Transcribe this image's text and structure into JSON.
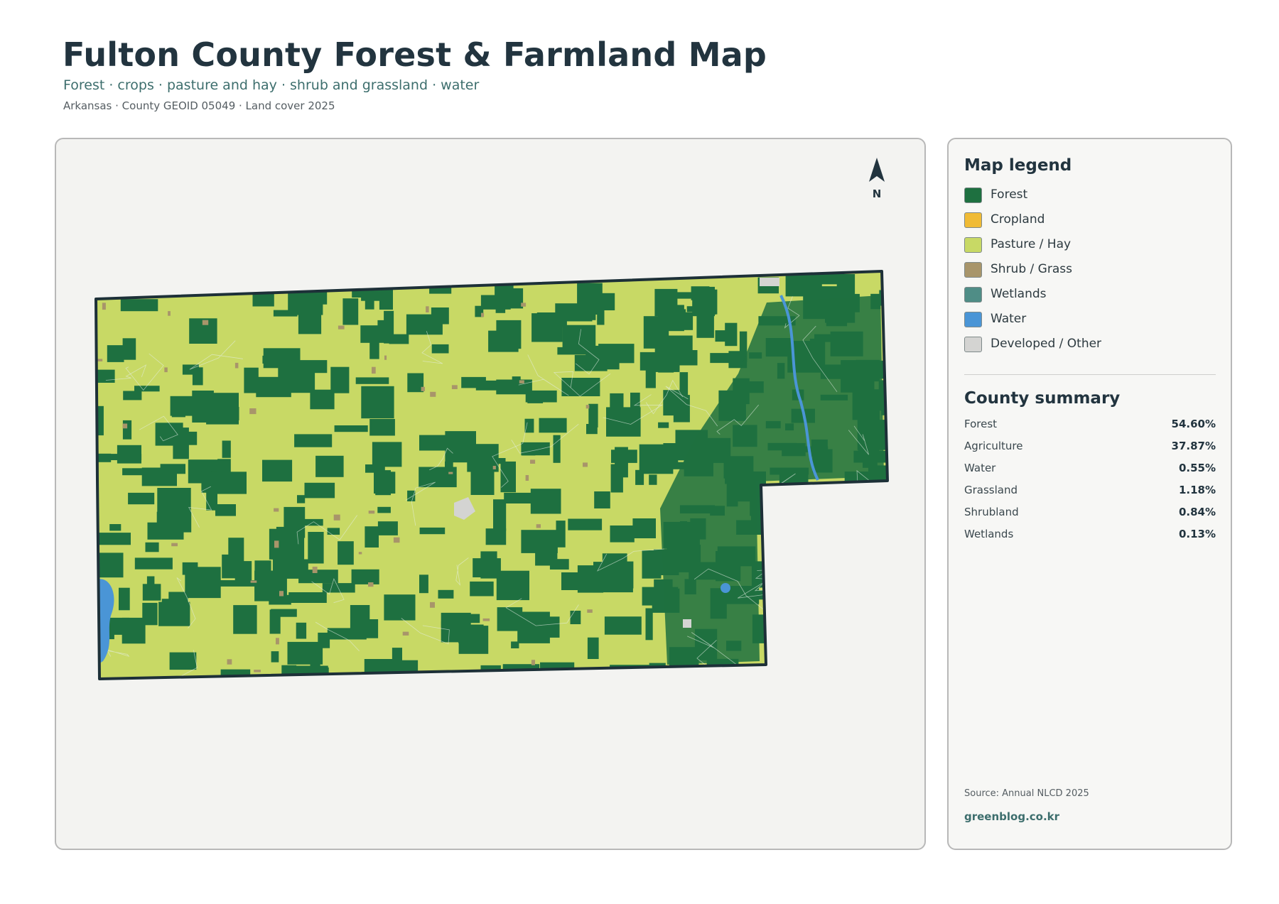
{
  "header": {
    "title": "Fulton County Forest & Farmland Map",
    "subtitle": "Forest · crops · pasture and hay · shrub and grassland · water",
    "meta": "Arkansas · County GEOID 05049 · Land cover 2025"
  },
  "map": {
    "north_label": "N",
    "colors": {
      "forest": "#1e7040",
      "pasture": "#c8d965",
      "shrub": "#a8956a",
      "water": "#4a95d6",
      "developed": "#d4d4d2",
      "outline": "#1d3038",
      "background": "#f3f3f1"
    }
  },
  "legend": {
    "title": "Map legend",
    "items": [
      {
        "label": "Forest",
        "color": "#1e7040"
      },
      {
        "label": "Cropland",
        "color": "#f0bb35"
      },
      {
        "label": "Pasture / Hay",
        "color": "#c8d965"
      },
      {
        "label": "Shrub / Grass",
        "color": "#a8956a"
      },
      {
        "label": "Wetlands",
        "color": "#4f8d86"
      },
      {
        "label": "Water",
        "color": "#4a95d6"
      },
      {
        "label": "Developed / Other",
        "color": "#d4d4d2"
      }
    ]
  },
  "summary": {
    "title": "County summary",
    "rows": [
      {
        "name": "Forest",
        "value": "54.60%"
      },
      {
        "name": "Agriculture",
        "value": "37.87%"
      },
      {
        "name": "Water",
        "value": "0.55%"
      },
      {
        "name": "Grassland",
        "value": "1.18%"
      },
      {
        "name": "Shrubland",
        "value": "0.84%"
      },
      {
        "name": "Wetlands",
        "value": "0.13%"
      }
    ]
  },
  "footer": {
    "source": "Source: Annual NLCD 2025",
    "brand": "greenblog.co.kr"
  }
}
